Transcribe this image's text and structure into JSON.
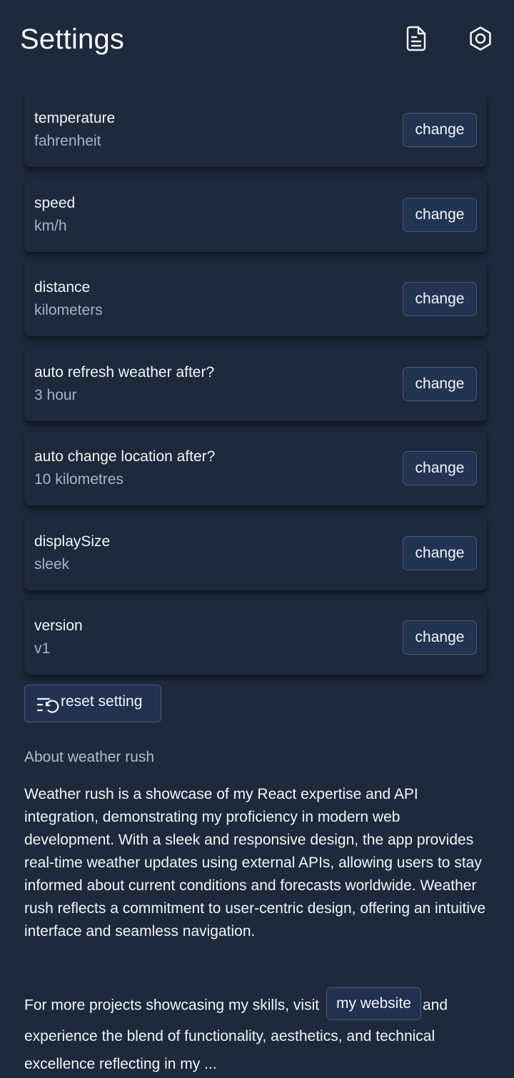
{
  "header": {
    "title": "Settings",
    "icons": [
      "document-icon",
      "settings-icon"
    ]
  },
  "settings": [
    {
      "name": "temperature",
      "value": "fahrenheit",
      "button": "change"
    },
    {
      "name": "speed",
      "value": "km/h",
      "button": "change"
    },
    {
      "name": "distance",
      "value": "kilometers",
      "button": "change"
    },
    {
      "name": "auto refresh weather after?",
      "value": "3 hour",
      "button": "change"
    },
    {
      "name": "auto change location after?",
      "value": "10 kilometres",
      "button": "change"
    },
    {
      "name": "displaySize",
      "value": "sleek",
      "button": "change"
    },
    {
      "name": "version",
      "value": "v1",
      "button": "change"
    }
  ],
  "reset": {
    "label": "reset setting",
    "icon": "list-restart-icon"
  },
  "about": {
    "heading": "About weather rush",
    "text": "Weather rush is a showcase of my React expertise and API integration, demonstrating my proficiency in modern web development. With a sleek and responsive design, the app provides real-time weather updates using external APIs, allowing users to stay informed about current conditions and forecasts worldwide. Weather rush reflects a commitment to user-centric design, offering an intuitive interface and seamless navigation.",
    "more_prefix": "For more projects showcasing my skills, visit",
    "website_label": "my website",
    "more_suffix": "and experience the blend of functionality, aesthetics, and technical excellence reflecting in my ..."
  },
  "colors": {
    "background": "#1e293b",
    "button_background": "#233452",
    "button_border": "#4a5d7a",
    "text_primary": "#f1f5f9",
    "text_secondary": "#a8b3c2"
  }
}
